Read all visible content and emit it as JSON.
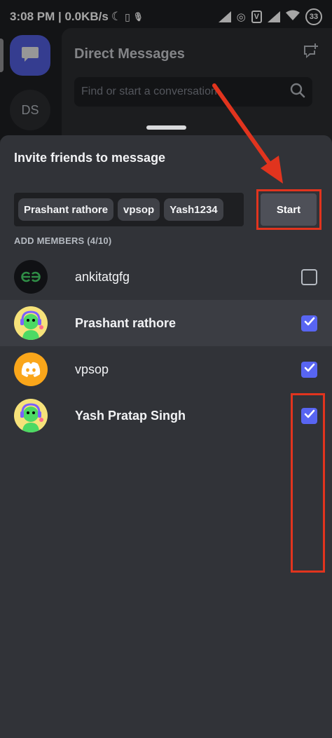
{
  "status_bar": {
    "time_speed": "3:08 PM | 0.0KB/s",
    "battery": "33",
    "volte": "V"
  },
  "background": {
    "rail_ds_label": "DS",
    "dm_title": "Direct Messages",
    "dm_search_placeholder": "Find or start a conversation"
  },
  "sheet": {
    "title": "Invite friends to message",
    "selected_chips": [
      "Prashant rathore",
      "vpsop",
      "Yash1234"
    ],
    "start_label": "Start",
    "section_label": "ADD MEMBERS (4/10)",
    "members": [
      {
        "name": "ankitatgfg",
        "checked": false,
        "avatar": "geeksforgeeks-logo"
      },
      {
        "name": "Prashant rathore",
        "checked": true,
        "avatar": "green-character"
      },
      {
        "name": "vpsop",
        "checked": true,
        "avatar": "discord-logo"
      },
      {
        "name": "Yash Pratap Singh",
        "checked": true,
        "avatar": "green-character"
      }
    ]
  },
  "colors": {
    "accent": "#5865f2",
    "annotation": "#e1341e",
    "sheet_bg": "#313338"
  }
}
